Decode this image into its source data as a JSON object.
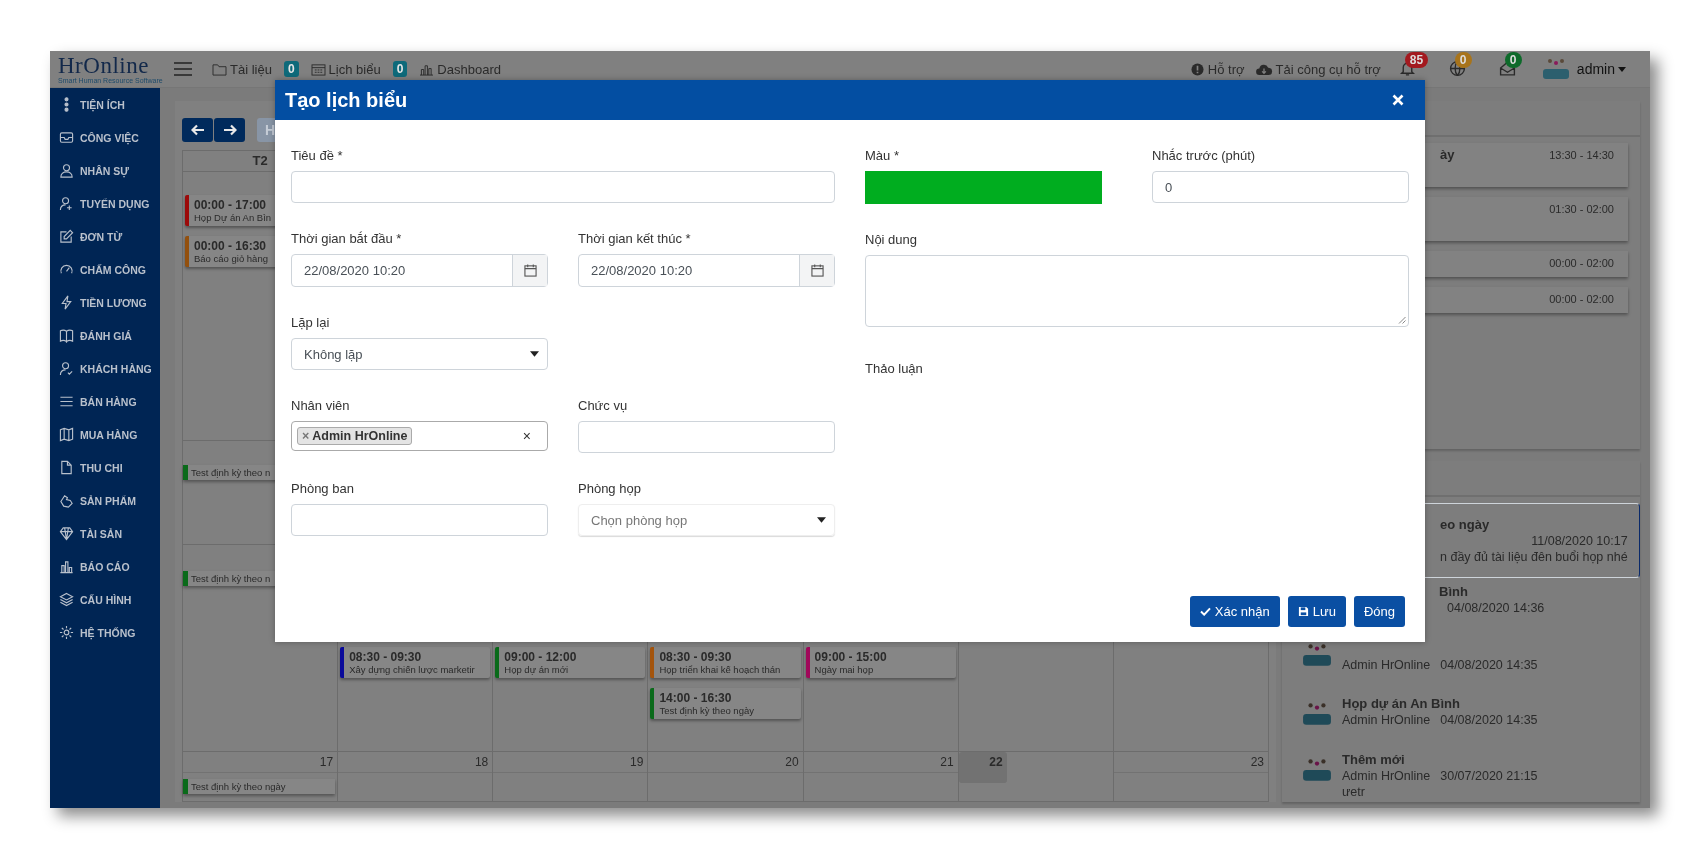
{
  "header": {
    "logo": "HrOnline",
    "logo_tagline": "Smart Human Resource Software",
    "nav": [
      {
        "label": "Tài liệu",
        "count": "0"
      },
      {
        "label": "Lịch biểu",
        "count": "0"
      },
      {
        "label": "Dashboard"
      }
    ],
    "help": "Hỗ trợ",
    "download": "Tải công cụ hỗ trợ",
    "notifications": [
      {
        "count": "85",
        "color": "#a3191f"
      },
      {
        "count": "0",
        "color": "#a8741b"
      },
      {
        "count": "0",
        "color": "#0d6a2a"
      }
    ],
    "user": "admin"
  },
  "sidebar": {
    "items": [
      "TIỆN ÍCH",
      "CÔNG VIỆC",
      "NHÂN SỰ",
      "TUYỂN DỤNG",
      "ĐƠN TỪ",
      "CHẤM CÔNG",
      "TIỀN LƯƠNG",
      "ĐÁNH GIÁ",
      "KHÁCH HÀNG",
      "BÁN HÀNG",
      "MUA HÀNG",
      "THU CHI",
      "SẢN PHẨM",
      "TÀI SẢN",
      "BÁO CÁO",
      "CẤU HÌNH",
      "HỆ THỐNG"
    ]
  },
  "calendar": {
    "today_button": "H",
    "day_header": "T2",
    "week_1_events": [
      {
        "time": "00:00 - 17:00",
        "title": "Họp Dự án An Bìn",
        "color": "#9c0a0a"
      },
      {
        "time": "00:00 - 16:30",
        "title": "Báo cáo giỏ hàng",
        "color": "#93500e"
      }
    ],
    "week_2_all_day": [
      {
        "title": "Test định kỳ theo n",
        "color": "#0a6a1a"
      }
    ],
    "week_3_all_day": [
      {
        "title": "Test định kỳ theo n",
        "color": "#0a6a1a"
      }
    ],
    "week_3_days": [
      {
        "events": [
          {
            "time": "08:30 - 09:30",
            "title": "Xây dựng chiến lược marketir",
            "color": "#0a0a9a"
          }
        ]
      },
      {
        "events": [
          {
            "time": "09:00 - 12:00",
            "title": "Họp dự án mới",
            "color": "#0a6a1a"
          }
        ]
      },
      {
        "events": [
          {
            "time": "08:30 - 09:30",
            "title": "Họp triển khai kế hoạch thán",
            "color": "#a4540c"
          },
          {
            "time": "14:00 - 16:30",
            "title": "Test định kỳ theo ngày",
            "color": "#0a6a1a"
          }
        ]
      },
      {
        "events": [
          {
            "time": "09:00 - 15:00",
            "title": "Ngày mai họp",
            "color": "#a0085a"
          }
        ]
      }
    ],
    "week_4_dates": [
      {
        "label": "17",
        "today": false
      },
      {
        "label": "18",
        "today": false
      },
      {
        "label": "19",
        "today": false
      },
      {
        "label": "20",
        "today": false
      },
      {
        "label": "21",
        "today": false
      },
      {
        "label": "22",
        "today": true
      },
      {
        "label": "23",
        "today": false
      }
    ],
    "week_4_all_day": [
      {
        "title": "Test định kỳ theo ngày",
        "color": "#0a6a1a"
      }
    ]
  },
  "schedule_panel": {
    "items": [
      {
        "title": "ày",
        "time": "13:30 - 14:30"
      },
      {
        "time": "01:30 - 02:00"
      },
      {
        "time": "00:00 - 02:00"
      },
      {
        "time": "00:00 - 02:00"
      }
    ]
  },
  "activity_panel": {
    "items": [
      {
        "kind": "clipped",
        "title": "eo ngày",
        "date": "11/08/2020 10:17",
        "message": "n đầy đủ tài liệu đên buổi họp nhé",
        "selected": true
      },
      {
        "kind": "clipped",
        "title": "Bình",
        "date": "04/08/2020 14:36",
        "selected": false
      },
      {
        "kind": "full",
        "author": "Admin HrOnline",
        "date": "04/08/2020 14:35",
        "selected": false
      },
      {
        "kind": "full",
        "title": "Họp dự án An Bình",
        "author": "Admin HrOnline",
        "date": "04/08/2020 14:35",
        "selected": false
      },
      {
        "kind": "full",
        "title": "Thêm mới",
        "author": "Admin HrOnline",
        "date": "30/07/2020 21:15",
        "message": "ưetr",
        "selected": false
      }
    ]
  },
  "modal": {
    "title": "Tạo lịch biểu",
    "left_rows": [
      [
        {
          "kind": "text",
          "label": "Tiêu đề *"
        }
      ],
      [
        {
          "kind": "datetime",
          "label": "Thời gian bắt đầu *",
          "value": "22/08/2020 10:20"
        },
        {
          "kind": "datetime",
          "label": "Thời gian kết thúc *",
          "value": "22/08/2020 10:20"
        }
      ],
      [
        {
          "kind": "select",
          "label": "Lặp lại",
          "value": "Không lặp"
        }
      ],
      [
        {
          "kind": "tags",
          "label": "Nhân viên",
          "tags": [
            "Admin HrOnline"
          ],
          "remove_mark": "×",
          "clear_mark": "×"
        },
        {
          "kind": "text",
          "label": "Chức vụ"
        }
      ],
      [
        {
          "kind": "text",
          "label": "Phòng ban"
        },
        {
          "kind": "select",
          "label": "Phòng họp",
          "placeholder": "Chọn phòng họp"
        }
      ]
    ],
    "right_rows": [
      [
        {
          "kind": "color",
          "label": "Màu *",
          "color": "#00ad1f"
        },
        {
          "kind": "text",
          "label": "Nhắc trước (phút)",
          "value": "0"
        }
      ],
      [
        {
          "kind": "textarea",
          "label": "Nội dung"
        }
      ],
      [
        {
          "kind": "heading",
          "label": "Thảo luận"
        }
      ]
    ],
    "buttons": [
      {
        "kind": "confirm",
        "label": "Xác nhận"
      },
      {
        "kind": "save",
        "label": "Lưu"
      },
      {
        "kind": "close",
        "label": "Đóng"
      }
    ]
  }
}
